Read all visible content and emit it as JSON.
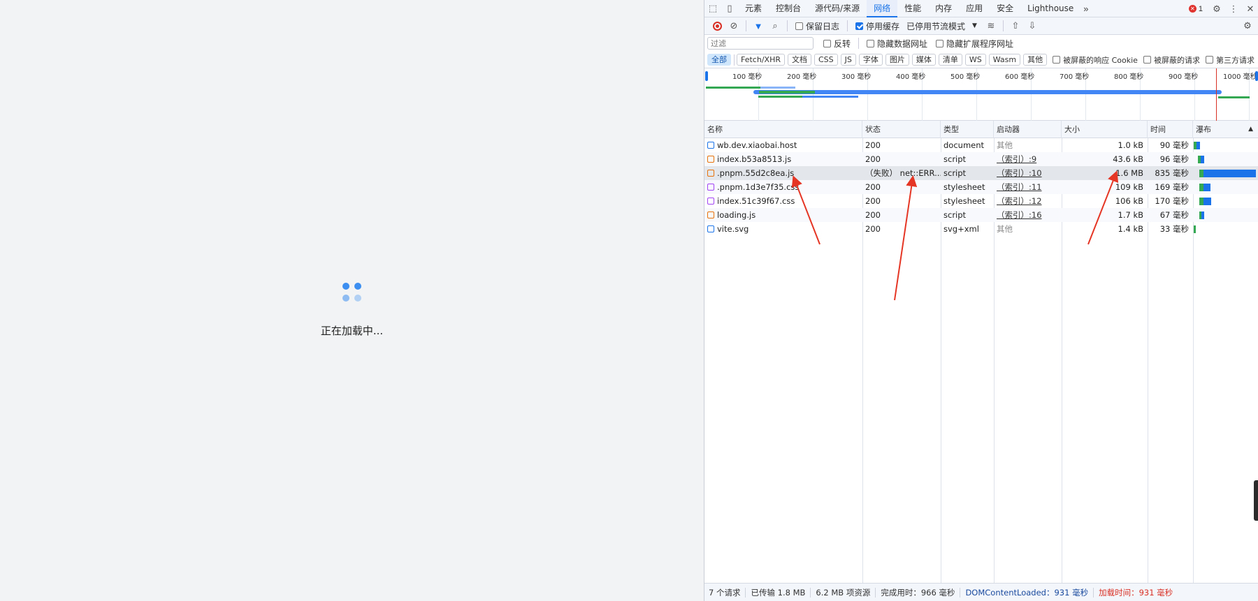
{
  "page": {
    "loading_text": "正在加载中..."
  },
  "devtools": {
    "tabs": [
      "元素",
      "控制台",
      "源代码/来源",
      "网络",
      "性能",
      "内存",
      "应用",
      "安全",
      "Lighthouse"
    ],
    "active_tab": "网络",
    "error_count": "1",
    "toolbar": {
      "preserve_log": "保留日志",
      "disable_cache": "停用缓存",
      "throttling": "已停用节流模式"
    },
    "filter": {
      "placeholder": "过滤",
      "invert": "反转",
      "hide_data_urls": "隐藏数据网址",
      "hide_extension_urls": "隐藏扩展程序网址"
    },
    "type_filters": [
      "全部",
      "Fetch/XHR",
      "文档",
      "CSS",
      "JS",
      "字体",
      "图片",
      "媒体",
      "清单",
      "WS",
      "Wasm",
      "其他"
    ],
    "blocked_cookies": "被屏蔽的响应 Cookie",
    "blocked_requests": "被屏蔽的请求",
    "third_party": "第三方请求",
    "overview_ticks": [
      "100 毫秒",
      "200 毫秒",
      "300 毫秒",
      "400 毫秒",
      "500 毫秒",
      "600 毫秒",
      "700 毫秒",
      "800 毫秒",
      "900 毫秒",
      "1000 毫秒"
    ],
    "columns": {
      "name": "名称",
      "status": "状态",
      "type": "类型",
      "initiator": "启动器",
      "size": "大小",
      "time": "时间",
      "waterfall": "瀑布"
    },
    "requests": [
      {
        "name": "wb.dev.xiaobai.host",
        "status": "200",
        "type": "document",
        "initiator": "其他",
        "size": "1.0 kB",
        "time": "90 毫秒",
        "icon": "document-icon",
        "icon_color": "#1a73e8"
      },
      {
        "name": "index.b53a8513.js",
        "status": "200",
        "type": "script",
        "initiator": "（索引）:9",
        "size": "43.6 kB",
        "time": "96 毫秒",
        "icon": "script-icon",
        "icon_color": "#e8710a"
      },
      {
        "name": ".pnpm.55d2c8ea.js",
        "status": "（失败） net::ERR...",
        "type": "script",
        "initiator": "（索引）:10",
        "size": "1.6 MB",
        "time": "835 毫秒",
        "icon": "script-icon",
        "icon_color": "#e8710a"
      },
      {
        "name": ".pnpm.1d3e7f35.css",
        "status": "200",
        "type": "stylesheet",
        "initiator": "（索引）:11",
        "size": "109 kB",
        "time": "169 毫秒",
        "icon": "stylesheet-icon",
        "icon_color": "#a142f4"
      },
      {
        "name": "index.51c39f67.css",
        "status": "200",
        "type": "stylesheet",
        "initiator": "（索引）:12",
        "size": "106 kB",
        "time": "170 毫秒",
        "icon": "stylesheet-icon",
        "icon_color": "#a142f4"
      },
      {
        "name": "loading.js",
        "status": "200",
        "type": "script",
        "initiator": "（索引）:16",
        "size": "1.7 kB",
        "time": "67 毫秒",
        "icon": "script-icon",
        "icon_color": "#e8710a"
      },
      {
        "name": "vite.svg",
        "status": "200",
        "type": "svg+xml",
        "initiator": "其他",
        "size": "1.4 kB",
        "time": "33 毫秒",
        "icon": "image-icon",
        "icon_color": "#1a73e8"
      }
    ],
    "summary": {
      "requests": "7 个请求",
      "transferred": "已传输 1.8 MB",
      "resources": "6.2 MB 项资源",
      "finish": "完成用时：966 毫秒",
      "dcl": "DOMContentLoaded：931 毫秒",
      "load": "加载时间：931 毫秒"
    },
    "colors": {
      "accent": "#1a73e8",
      "error": "#d93025",
      "waterfall_wait": "#34a853",
      "waterfall_download": "#1a73e8"
    }
  }
}
